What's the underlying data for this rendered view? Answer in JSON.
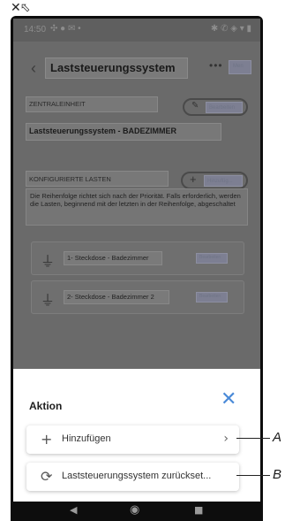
{
  "corner": {
    "icon": "close-resize-icon",
    "glyph": "✕⬁"
  },
  "status_bar": {
    "time": "14:50",
    "left_icons": "✣ ● ✉ •",
    "right_icons": "✱ ✆ ◈ ▾ ▮"
  },
  "header": {
    "back_glyph": "‹",
    "title": "Laststeuerungssystem",
    "more_glyph": "•••",
    "menu_label": "Men"
  },
  "central_unit": {
    "section_label": "ZENTRALEINHEIT",
    "edit_label": "Bearbeiten",
    "edit_glyph": "✎",
    "value": "Laststeuerungssystem - BADEZIMMER"
  },
  "configured_loads": {
    "section_label": "KONFIGURIERTE LASTEN",
    "add_label": "Hinzufüg...",
    "add_glyph": "+",
    "description": "Die Reihenfolge richtet sich nach der Priorität. Falls erforderlich, werden die Lasten, beginnend mit der letzten in der Reihenfolge, abgeschaltet",
    "items": [
      {
        "name": "1- Steckdose - Badezimmer",
        "edit_label": "Bearbeiten",
        "icon_glyph": "⏚"
      },
      {
        "name": "2- Steckdose - Badezimmer 2",
        "edit_label": "Bearbeiten",
        "icon_glyph": "⏚"
      }
    ]
  },
  "sheet": {
    "title": "Aktion",
    "close_glyph": "✕",
    "actions": [
      {
        "icon": "plus-icon",
        "glyph": "+",
        "label": "Hinzufügen",
        "chevron": "›"
      },
      {
        "icon": "reset-icon",
        "glyph": "⟳",
        "label": "Laststeuerungssystem zurückset..."
      }
    ]
  },
  "nav_bar": {
    "back": "◀",
    "home": "◉",
    "recents": "■"
  },
  "callouts": {
    "a": "A",
    "b": "B"
  }
}
